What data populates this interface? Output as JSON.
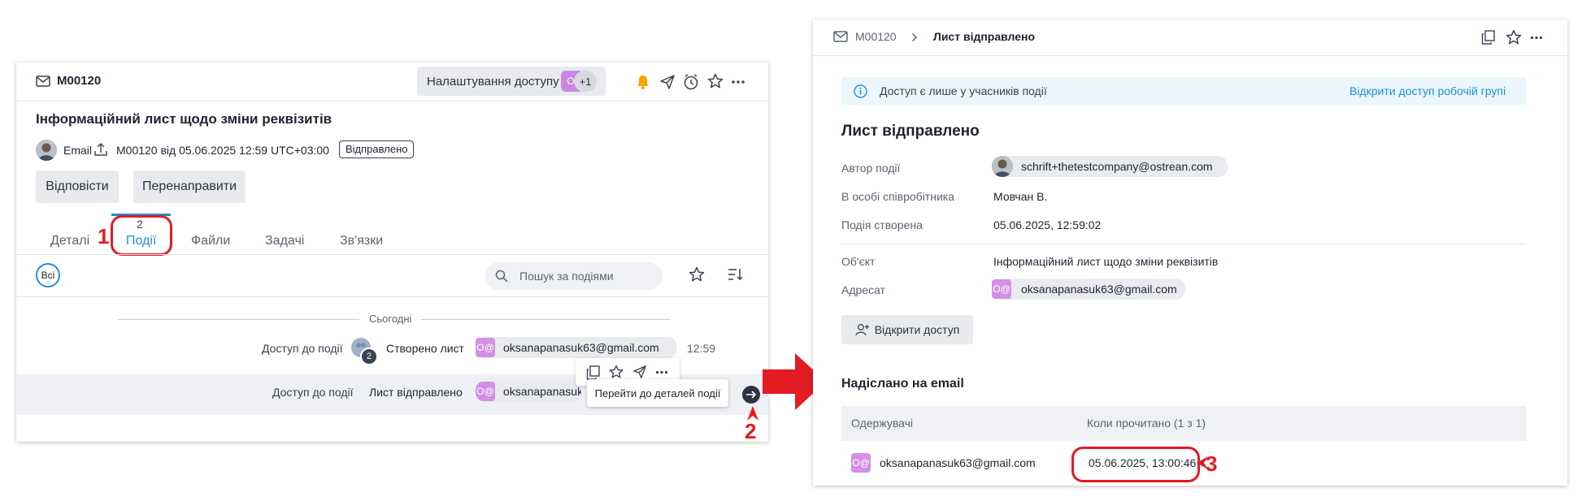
{
  "left": {
    "record_id": "M00120",
    "access_settings_label": "Налаштування доступу",
    "access_avatar_text": "О",
    "access_more": "+1",
    "title": "Інформаційний лист щодо зміни реквізитів",
    "meta_channel": "Email",
    "meta_ref": "M00120 від 05.06.2025 12:59 UTC+03:00",
    "status_badge": "Відправлено",
    "reply_label": "Відповісти",
    "forward_label": "Перенаправити",
    "tabs": [
      {
        "label": "Деталі"
      },
      {
        "label": "Події",
        "count": "2"
      },
      {
        "label": "Файли"
      },
      {
        "label": "Задачі"
      },
      {
        "label": "Зв'язки"
      }
    ],
    "filter_all": "Всі",
    "search_placeholder": "Пошук за подіями",
    "date_separator": "Сьогодні",
    "events": [
      {
        "access": "Доступ до події",
        "access_count": "2",
        "action": "Створено лист",
        "avatar": "О@",
        "email": "oksanapanasuk63@gmail.com",
        "time": "12:59"
      },
      {
        "access": "Доступ до події",
        "action": "Лист відправлено",
        "avatar": "О@",
        "email": "oksanapanasuk63@gmail.com"
      }
    ],
    "tooltip": "Перейти до деталей події"
  },
  "right": {
    "record_id": "M00120",
    "breadcrumb_current": "Лист відправлено",
    "info_text": "Доступ є лише у учасників події",
    "info_link": "Відкрити доступ робочій групі",
    "heading": "Лист відправлено",
    "fields": {
      "author_label": "Автор події",
      "author_value": "schrift+thetestcompany@ostrean.com",
      "employee_label": "В особі співробітника",
      "employee_value": "Мовчан В.",
      "created_label": "Подія створена",
      "created_value": "05.06.2025, 12:59:02",
      "object_label": "Об'єкт",
      "object_value": "Інформаційний лист щодо зміни реквізитів",
      "recipient_label": "Адресат",
      "recipient_avatar": "О@",
      "recipient_value": "oksanapanasuk63@gmail.com"
    },
    "open_access_button": "Відкрити доступ",
    "sent_heading": "Надіслано на email",
    "table": {
      "col_recipients": "Одержувачі",
      "col_read": "Коли прочитано (1 з 1)",
      "rows": [
        {
          "avatar": "О@",
          "email": "oksanapanasuk63@gmail.com",
          "read_at": "05.06.2025, 13:00:46"
        }
      ]
    }
  },
  "annotations": {
    "n1": "1",
    "n2": "2",
    "n3": "3"
  },
  "colors": {
    "accent_blue": "#1e90d6",
    "annotation_red": "#e31b23",
    "avatar_purple": "#d48fe6",
    "bell_orange": "#f5a400"
  }
}
